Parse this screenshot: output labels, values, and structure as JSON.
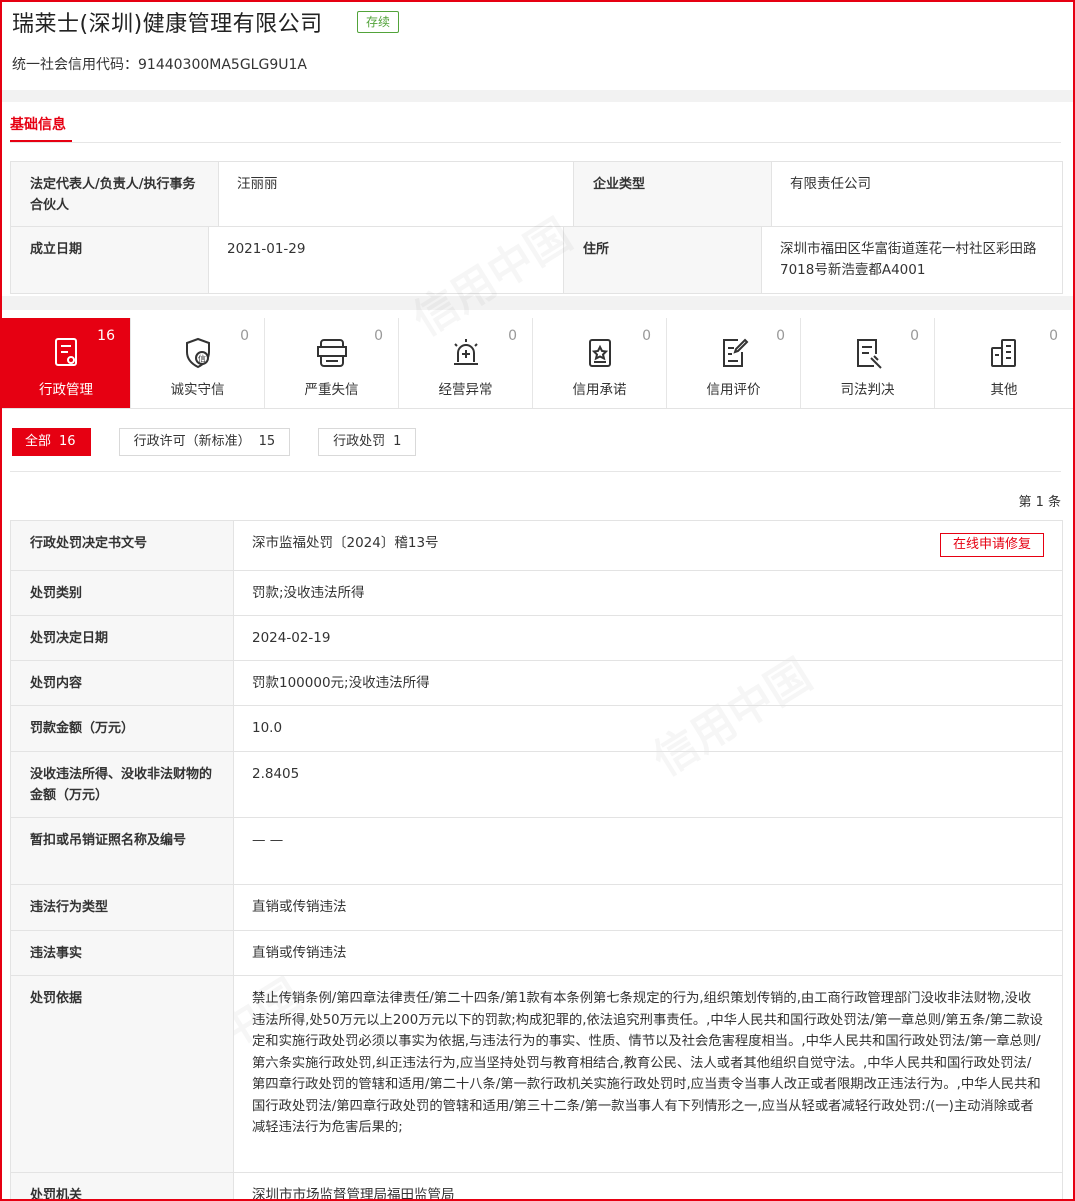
{
  "company": {
    "name": "瑞莱士(深圳)健康管理有限公司",
    "status": "存续",
    "credit_code_label": "统一社会信用代码：",
    "credit_code": "91440300MA5GLG9U1A"
  },
  "section_tab": "基础信息",
  "basic_info": {
    "rows": [
      {
        "k1": "法定代表人/负责人/执行事务合伙人",
        "v1": "汪丽丽",
        "k2": "企业类型",
        "v2": "有限责任公司"
      },
      {
        "k1": "成立日期",
        "v1": "2021-01-29",
        "k2": "住所",
        "v2": "深圳市福田区华富街道莲花一村社区彩田路7018号新浩壹都A4001"
      }
    ]
  },
  "categories": [
    {
      "label": "行政管理",
      "count": "16",
      "icon": "admin-document-icon"
    },
    {
      "label": "诚实守信",
      "count": "0",
      "icon": "honesty-shield-icon"
    },
    {
      "label": "严重失信",
      "count": "0",
      "icon": "dishonest-list-icon"
    },
    {
      "label": "经营异常",
      "count": "0",
      "icon": "alarm-light-icon"
    },
    {
      "label": "信用承诺",
      "count": "0",
      "icon": "commitment-badge-icon"
    },
    {
      "label": "信用评价",
      "count": "0",
      "icon": "evaluation-edit-icon"
    },
    {
      "label": "司法判决",
      "count": "0",
      "icon": "judgment-document-icon"
    },
    {
      "label": "其他",
      "count": "0",
      "icon": "other-building-icon"
    }
  ],
  "filters": [
    {
      "label": "全部",
      "count": "16"
    },
    {
      "label": "行政许可（新标准）",
      "count": "15"
    },
    {
      "label": "行政处罚",
      "count": "1"
    }
  ],
  "page_count": "第 1 条",
  "repair_button": "在线申请修复",
  "watermark_text": "信用中国",
  "detail": [
    {
      "k": "行政处罚决定书文号",
      "v": "深市监福处罚〔2024〕稽13号"
    },
    {
      "k": "处罚类别",
      "v": "罚款;没收违法所得"
    },
    {
      "k": "处罚决定日期",
      "v": "2024-02-19"
    },
    {
      "k": "处罚内容",
      "v": "罚款100000元;没收违法所得"
    },
    {
      "k": "罚款金额（万元）",
      "v": "10.0"
    },
    {
      "k": "没收违法所得、没收非法财物的金额（万元）",
      "v": "2.8405"
    },
    {
      "k": "暂扣或吊销证照名称及编号",
      "v": "— —"
    },
    {
      "k": "违法行为类型",
      "v": "直销或传销违法"
    },
    {
      "k": "违法事实",
      "v": "直销或传销违法"
    },
    {
      "k": "处罚依据",
      "v": "禁止传销条例/第四章法律责任/第二十四条/第1款有本条例第七条规定的行为,组织策划传销的,由工商行政管理部门没收非法财物,没收违法所得,处50万元以上200万元以下的罚款;构成犯罪的,依法追究刑事责任。,中华人民共和国行政处罚法/第一章总则/第五条/第二款设定和实施行政处罚必须以事实为依据,与违法行为的事实、性质、情节以及社会危害程度相当。,中华人民共和国行政处罚法/第一章总则/第六条实施行政处罚,纠正违法行为,应当坚持处罚与教育相结合,教育公民、法人或者其他组织自觉守法。,中华人民共和国行政处罚法/第四章行政处罚的管辖和适用/第二十八条/第一款行政机关实施行政处罚时,应当责令当事人改正或者限期改正违法行为。,中华人民共和国行政处罚法/第四章行政处罚的管辖和适用/第三十二条/第一款当事人有下列情形之一,应当从轻或者减轻行政处罚:/(一)主动消除或者减轻违法行为危害后果的;"
    },
    {
      "k": "处罚机关",
      "v": "深圳市市场监督管理局福田监管局"
    }
  ]
}
